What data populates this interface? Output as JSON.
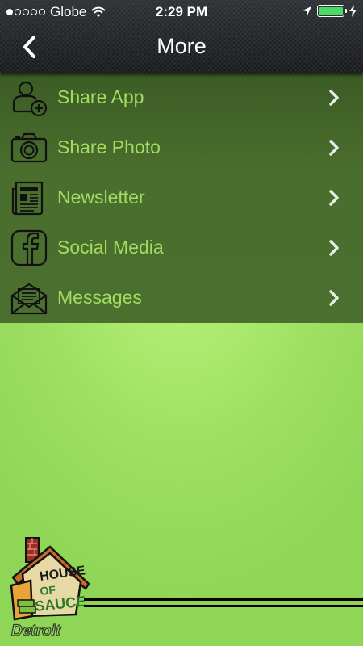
{
  "status_bar": {
    "carrier": "Globe",
    "signal_bars_filled": 1,
    "signal_bars_total": 5,
    "time": "2:29 PM",
    "battery_level": 1.0
  },
  "nav": {
    "title": "More",
    "back_icon": "chevron-left-icon"
  },
  "menu": {
    "items": [
      {
        "label": "Share App",
        "icon": "add-user-icon"
      },
      {
        "label": "Share Photo",
        "icon": "camera-icon"
      },
      {
        "label": "Newsletter",
        "icon": "newspaper-icon"
      },
      {
        "label": "Social Media",
        "icon": "facebook-icon"
      },
      {
        "label": "Messages",
        "icon": "envelope-icon"
      }
    ]
  },
  "logo": {
    "name": "house-logo",
    "caption": "Detroit"
  },
  "colors": {
    "menu_bg": "#4a6e2e",
    "label": "#a4dc62",
    "page_bg": "#a6e466",
    "topbar": "#1f2226"
  }
}
